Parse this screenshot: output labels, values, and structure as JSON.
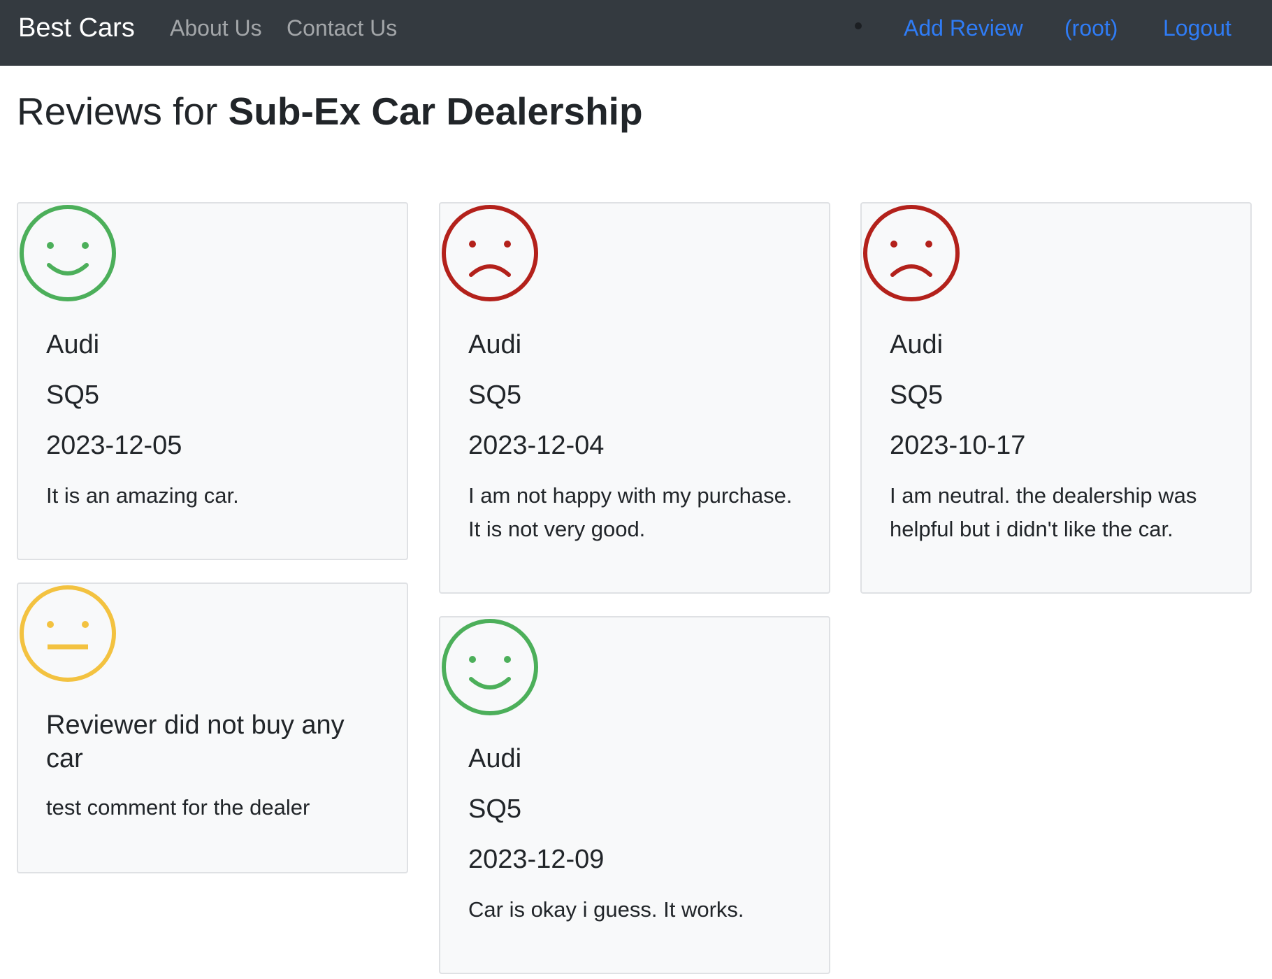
{
  "navbar": {
    "brand": "Best Cars",
    "links": [
      "About Us",
      "Contact Us"
    ],
    "right": {
      "add_review": "Add Review",
      "user": "(root)",
      "logout": "Logout"
    }
  },
  "page": {
    "title_prefix": "Reviews for",
    "dealer_name": "Sub-Ex Car Dealership"
  },
  "colors": {
    "positive": "#4caf5a",
    "negative": "#b3211b",
    "neutral": "#f3c240"
  },
  "reviews": [
    {
      "sentiment": "positive",
      "icon": "smiley-face-icon",
      "make": "Audi",
      "model": "SQ5",
      "date": "2023-12-05",
      "text": "It is an amazing car."
    },
    {
      "sentiment": "negative",
      "icon": "frown-face-icon",
      "make": "Audi",
      "model": "SQ5",
      "date": "2023-12-04",
      "text": "I am not happy with my purchase. It is not very good."
    },
    {
      "sentiment": "negative",
      "icon": "frown-face-icon",
      "make": "Audi",
      "model": "SQ5",
      "date": "2023-10-17",
      "text": "I am neutral. the dealership was helpful but i didn't like the car."
    },
    {
      "sentiment": "neutral",
      "icon": "neutral-face-icon",
      "heading": "Reviewer did not buy any car",
      "text": "test comment for the dealer"
    },
    {
      "sentiment": "positive",
      "icon": "smiley-face-icon",
      "make": "Audi",
      "model": "SQ5",
      "date": "2023-12-09",
      "text": "Car is okay i guess. It works."
    }
  ]
}
